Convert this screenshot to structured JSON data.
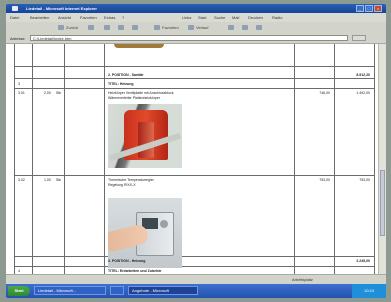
{
  "window": {
    "title": "Liedetail - Microsoft Internet Explorer"
  },
  "menu": [
    "Datei",
    "Bearbeiten",
    "Ansicht",
    "Favoriten",
    "Extras",
    "?",
    "Links",
    "Start",
    "Suche",
    "Mail",
    "Drucken",
    "Radio"
  ],
  "toolbar": {
    "buttons": [
      "Zurück",
      "Vorwärts",
      "Stopp",
      "Aktualisieren",
      "Startseite",
      "Favoriten",
      "Verlauf"
    ]
  },
  "address": {
    "label": "Adresse",
    "value": "C:\\Liedetail\\index.htm",
    "go": "Wechseln zu"
  },
  "table": {
    "rows": [
      {
        "pos": "",
        "qty": "",
        "unit": "",
        "text": "2. POSITION - Sanitär",
        "ep": "",
        "gp": "8.912,20",
        "kind": "sum"
      },
      {
        "pos": "3",
        "qty": "",
        "unit": "",
        "text": "TITEL: Heizung",
        "ep": "",
        "gp": "",
        "kind": "title"
      },
      {
        "pos": "3.01",
        "qty": "2,00",
        "unit": "Stk",
        "text": "Heizkörper Ventilplatte mit Anschlussblock",
        "text2": "Wärmeverteiler Plattenheizkörper",
        "ep": "746,00",
        "gp": "1.492,00",
        "kind": "item"
      },
      {
        "pos": "3.02",
        "qty": "1,00",
        "unit": "Stk",
        "text": "Thermische Temperaturregler",
        "text2": "Regelung RIXX-X",
        "ep": "753,00",
        "gp": "753,00",
        "kind": "item"
      },
      {
        "pos": "",
        "qty": "",
        "unit": "",
        "text": "3. POSITION - Heizung",
        "ep": "",
        "gp": "2.245,00",
        "kind": "sum"
      },
      {
        "pos": "4",
        "qty": "",
        "unit": "",
        "text": "TITEL: Erdarbeiten und Zubehör",
        "ep": "",
        "gp": "",
        "kind": "title"
      }
    ]
  },
  "status": {
    "zone": "Arbeitsplatz"
  },
  "taskbar": {
    "start": "Start",
    "tasks": [
      "Liedetail - Microsoft...",
      "Ausgabe - Microsoft Word",
      "Angebote - Microsoft"
    ],
    "clock": "10:24"
  }
}
